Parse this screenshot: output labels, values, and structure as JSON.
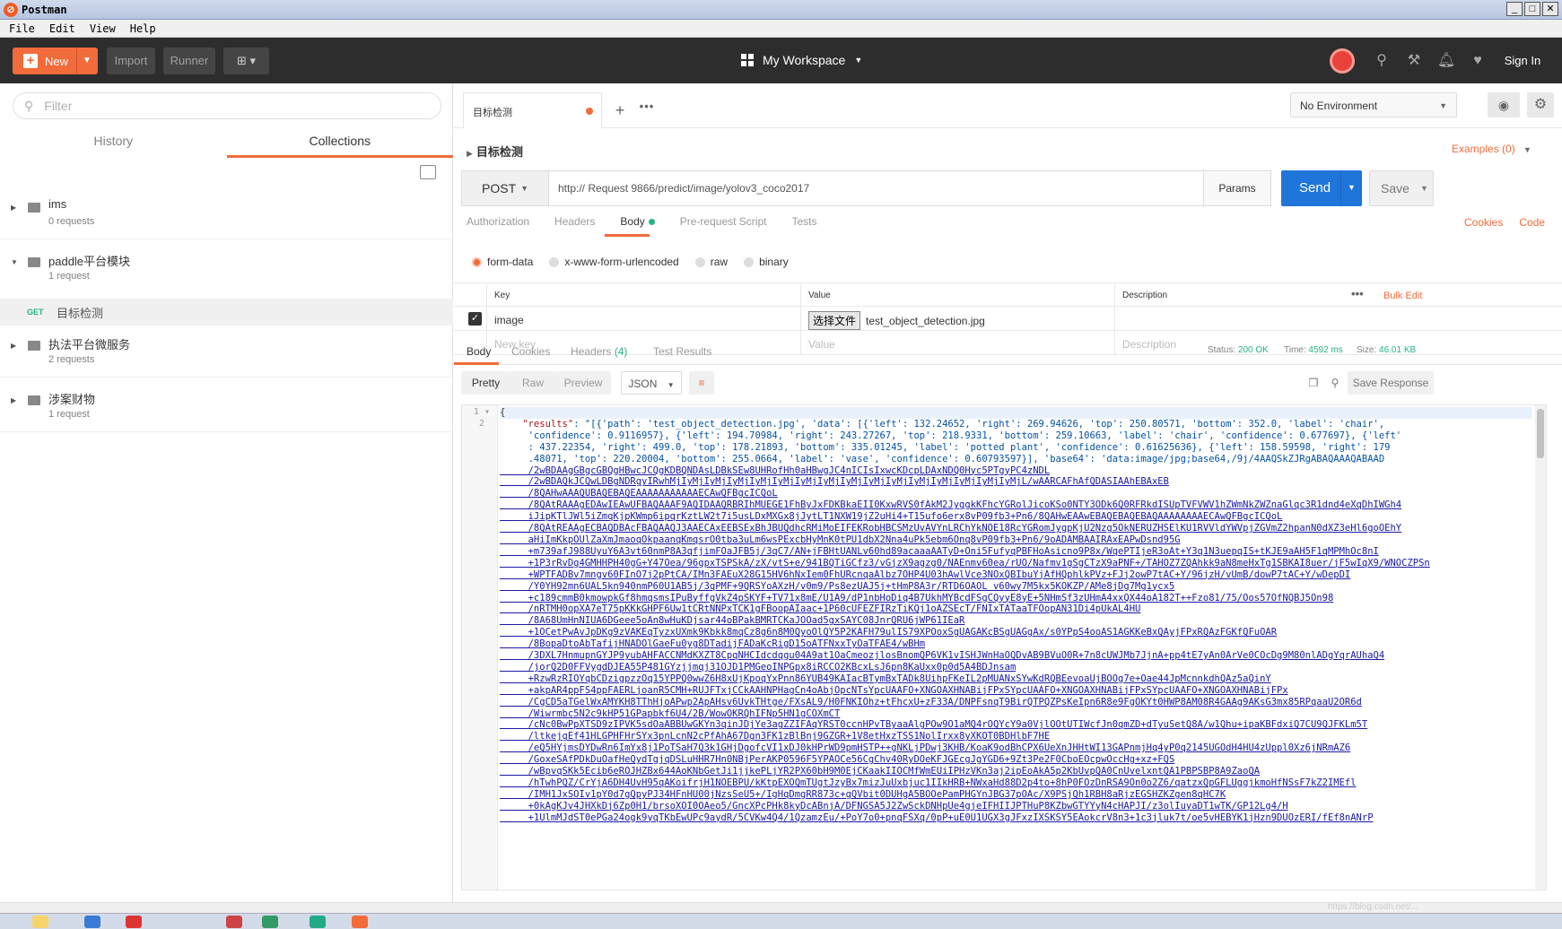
{
  "app": {
    "title": "Postman"
  },
  "menu": [
    "File",
    "Edit",
    "View",
    "Help"
  ],
  "toolbar": {
    "new_label": "New",
    "import_label": "Import",
    "runner_label": "Runner",
    "workspace": "My Workspace",
    "signin_label": "Sign In"
  },
  "sidebar": {
    "filter_placeholder": "Filter",
    "tabs": [
      "History",
      "Collections"
    ],
    "active_tab": "Collections",
    "collections": [
      {
        "name": "ims",
        "count": "0 requests"
      },
      {
        "name": "paddle平台模块",
        "count": "1 request",
        "expanded": true
      },
      {
        "name": "执法平台微服务",
        "count": "2 requests"
      },
      {
        "name": "涉案财物",
        "count": "1 request"
      }
    ],
    "open_request": {
      "method": "GET",
      "name": "目标检测"
    }
  },
  "tab": {
    "title": "目标检测"
  },
  "environment": {
    "selected": "No Environment"
  },
  "request": {
    "title": "目标检测",
    "examples_label": "Examples (0)",
    "method": "POST",
    "url": "http://          Request 9866/predict/image/yolov3_coco2017",
    "params_label": "Params",
    "send_label": "Send",
    "save_label": "Save",
    "subtabs": [
      "Authorization",
      "Headers",
      "Body",
      "Pre-request Script",
      "Tests"
    ],
    "active_subtab": "Body",
    "cookies_label": "Cookies",
    "code_label": "Code",
    "body_types": [
      "form-data",
      "x-www-form-urlencoded",
      "raw",
      "binary"
    ],
    "selected_body_type": "form-data",
    "table": {
      "headers": {
        "key": "Key",
        "value": "Value",
        "description": "Description"
      },
      "bulk_edit": "Bulk Edit",
      "rows": [
        {
          "key": "image",
          "file_button": "选择文件",
          "value": "test_object_detection.jpg",
          "checked": true
        }
      ],
      "placeholders": {
        "key": "New key",
        "value": "Value",
        "description": "Description"
      }
    }
  },
  "response": {
    "tabs": {
      "body": "Body",
      "cookies": "Cookies",
      "headers": "Headers",
      "headers_count": "(4)",
      "tests": "Test Results"
    },
    "status_label": "Status:",
    "status": "200 OK",
    "time_label": "Time:",
    "time": "4592 ms",
    "size_label": "Size:",
    "size": "46.01 KB",
    "view_buttons": [
      "Pretty",
      "Raw",
      "Preview"
    ],
    "format": "JSON",
    "save_response_label": "Save Response",
    "line_numbers": [
      "1",
      "2"
    ],
    "code_lines": [
      "{",
      "    \"results\": \"[{'path': 'test_object_detection.jpg', 'data': [{'left': 132.24652, 'right': 269.94626, 'top': 250.80571, 'bottom': 352.0, 'label': 'chair',",
      "     'confidence': 0.9116957}, {'left': 194.70984, 'right': 243.27267, 'top': 218.9331, 'bottom': 259.10663, 'label': 'chair', 'confidence': 0.677697}, {'left'",
      "     : 437.22354, 'right': 499.0, 'top': 178.21893, 'bottom': 335.01245, 'label': 'potted plant', 'confidence': 0.61625636}, {'left': 158.59598, 'right': 179",
      "     .48071, 'top': 220.20004, 'bottom': 255.0664, 'label': 'vase', 'confidence': 0.60793597}], 'base64': 'data:image/jpg;base64,/9j/4AAQSkZJRgABAQAAAQABAAD",
      "     /2wBDAAgGBgcGBQgHBwcJCQgKDBQNDAsLDBkSEw8UHRofHh0aHBwgJC4nICIsIxwcKDcpLDAxNDQ0Hyc5PTgyPC4zNDL",
      "     /2wBDAQkJCQwLDBgNDRgyIRwhMjIyMjIyMjIyMjIyMjIyMjIyMjIyMjIyMjIyMjIyMjIyMjIyMjIyMjIyMjIyMjL/wAARCAFhAfQDASIAAhEBAxEB",
      "     /8QAHwAAAQUBAQEBAQEAAAAAAAAAAAECAwQFBgcICQoL",
      "     /8QAtRAAAgEDAwIEAwUFBAQAAAF9AQIDAAQRBRIhMUEGE1FhByJxFDKBkaEII0KxwRVS0fAkM2JyggkKFhcYGRolJicoKSo0NTY3ODk6Q0RFRkdISUpTVFVWV1hZWmNkZWZnaGlqc3R1dnd4eXqDhIWGh4",
      "     iJipKTlJWl5iZmqKjpKWmp6ipqrKztLW2t7i5usLDxMXGx8jJytLT1NXW19jZ2uHi4+T15ufo6erx8vP09fb3+Pn6/8QAHwEAAwEBAQEBAQEBAQAAAAAAAAECAwQFBgcICQoL",
      "     /8QAtREAAgECBAQDBAcFBAQAAQJ3AAECAxEEBSExBhJBUQdhcRMiMoEIFEKRobHBCSMzUvAVYnLRChYkNOE18RcYGRomJygpKjU2Nzg5OkNERUZHSElKU1RVVldYWVpjZGVmZ2hpanN0dXZ3eHl6goOEhY",
      "     aHiImKkpOUlZaXmJmaoqOkpaanqKmqsrO0tba3uLm6wsPExcbHyMnK0tPU1dbX2Nna4uPk5ebm6Onq8vP09fb3+Pn6/9oADAMBAAIRAxEAPwDsnd95G",
      "     +m739afJ988UyuY6A3vt60nmP8A3qfjimFOaJFB5j/3qC7/AN+jFBHtUANLv60hd89acaaaAATyD+Oni5FufyqPBFHoAsicno9P8x/WqePTIjeR3oAt+Y3q1N3uepqIS+tKJE9aAH5F1qMPMhOc8nI",
      "     +1P3rRvDg4GMHHPH40gG+Y47Oea/96gpxTSPSkA/zX/vtS+e/941BQTiGCfz3/vGjzX9agzg0/NAEnmv60ea/rUO/Nafmv1gSgCTzX9aPNF+/TAHOZ7ZQAhkk9aN8meHxTg1SBKAI8uer/jF5wIqX9/WNOCZPSn",
      "     +WPTFADBv7mngv60FInO7j2pPtCA/IMn3FAEuX28G15HV6hNxIem0FhURcnqaAlbz7OHP4U03hAwlVce3NOxQBIbuYjAfHQphlkPVz+FJj2owP7tAC+Y/96jzH/vUmB/dowP7tAC+Y/wDepDI",
      "     /Y0YH92mn6UAL5kn940nmP60U1AB5j/3qPMF+9QRSYoAXzH/v0m9/Ps8ezUAJ5j+tHmP8A3r/RTD6OAOL v60wy7M5kx5KOKZP/AMe8jDg7Mg1ycx5",
      "     +c189cmmB0kmowpkGf8hmqsmsIPuByffgVkZ4pSKYF+TV71x8mE/U1A9/dP1nbHoDiq4B7UkhMYBcdFSgCQyyE8yE+5NHmSf3zUHmA4xxQX44oA182T++Fzo81/75/Oos57OfNQBJ5On98",
      "     /nRTMH0opXA7eT75pKKkGHPF6Uw1tCRtNNPxTCK1gFBoopAIaac+1P60cUFEZFIRzTiKQj1oAZSEcT/FNIxTATaaTFOopAN31Di4pUkAL4HU",
      "     /8A68UmHnNIUA6DGeee5oAn8wHuKDjsar44oBPakBMRTCKaJOOad5gxSAYC08JnrQRU6jWP61IEaR",
      "     +1OCetPwAvJpDKg9zVAKEqTyzxUXmk9Kbkk8mqCz8g6n8M0QyoOlQY5P2KAFH79ulIS79XPOoxSgUAGAKcBSgUAGgAx/s0YPpS4ooAS1AGKKeBxQAyjFPxRQAzFGKfQFuOAR",
      "     /8BopaDtoAbTafijHNADOlGaeFu0yg8DTadijFADaKcRigD15oATFNxxTyOaTFAE4/wBHm",
      "     /3DXL7HnmupnGYJP9yubAHFACCNMdKXZT8CpqNHCIdcdqgu04A9at1OaCmeozjlosBnomQP6VK1vISHJWnHaOQDvAB9BVuO0R+7n8cUWJMb7JjnA+pp4tE7yAn0ArVe0COcDg9M80nlADgYqrAUhaQ4",
      "     /jorQ2D0FFVygdDJEA55P481GYzjjmqj31OJD1PMGeoINPGpx8iRCCO2KBcxLsJ6pn8KaUxx0p0d5A4BDJnsam",
      "     +RzwRzRIOYqbCDzigpzzOq15YPPQ0wwZ6H8xUjKpoqYxPnn86YUB49KAIacBTymBxTADk8UihpFKeIL2pMUANxSYwKdRQBEevoaUjBOOg7e+Oae44JpMcnnkdhQAz5aQinY",
      "     +akpAR4ppFS4ppFAERLjoanR5CMH+RUJFTxjCCkAAHNPHagCn4oAbjOpcNTsYpcUAAFO+XNGOAXHNABijFPxSYpcUAAFO+XNGOAXHNABijFPxSYpcUAAFO+XNGOAXHNABijFPx",
      "     /CgCD5aTGelWxAMYKH8TThHjoAPwp2ApAHsv6UvkTHtge/FXsAL9/H0FNKIOhz+tFhcxU+zF33A/DNPFsnqT9BirQTPQZPsKeIpn6R8e9FgOKYt0HWP8AM08R4GAAg9AKsG3mx85RPqaaU2OR6d",
      "     /Wiwrmbc5N2c9kHP51GPapbkf6U4/2B/WowOKRQhIFNp5HN1gCOXmCT",
      "     /cNc0BwPpXTSD9zIPVK5sdOaABBUwGKYn3qinJDjYe3agZZIFAqYRST0ccnHPvTByaaAlgPOw9O1aMQ4rOQYcY9a0VjlOOtUTIWcfJn0qmZD+dTyuSetQ8A/w1Qhu+ipaKBFdxiQ7CU9QJFKLm5T",
      "     /ltkejgEf41HLGPHFHrSYx3pnLcnN2cPfAhA67Dgn3FK1zBlBnj9GZGR+1V8etHxzTSS1NolIrxx8yXKOT0BDHlbF7HE",
      "     /eQ5HYjmsDYDwRn6ImYx8j1PoTSaH7Q3k1GHjDgofcVI1xDJ0kHPrWD9pmHSTP++gNKLjPDwj3KHB/KoaK9odBhCPX6UeXnJHHtWI13GAPnmjHq4yP0q2145UGOdH4HU4zUppl0Xz6jNRmAZ6",
      "     /GoxeSAfPDkDuOafHeQydTgjqDSLuHHR7Hn0NBjPerAKP0596F5YPAOCe56CgChv40RyDOeKFJGEcgJgYGD6+9Zt3Pe2F0CboEOcpwOccHg+xz+FQS",
      "     /wBpvqSKk5Ecib6eROJHZBx644AoKNbGetJi1jjkePLjYR2PX60bH9M0EjCKaakIIOCMfWmEUiIPHzVKn3aj2ipEoAkA5p2KbUvpQA0CnUvelxntQA1PBPSBP8A9ZaoQA",
      "     /hTwhPQZ/CrYjA6DH4UvH95qAKoifrjH1NOEBPU/kKtpEXOQmTUgtJzyBx7mizJuUxbjuc1IIkHRB+NWxaHd88D2p4to+8hP0FOzDnRSA9On0o2Z6/qatzxQpGFLUggjkmoHfNSsF7kZ2IMEfl",
      "     /IMH1JxSOIv1pY0d7gQpyPJ34HFnHU00jNzsSeU5+/IgHqDmgRR873c+gQVbit0DUHgA5BOOePamPHGYnJBG37pOAc/X9PSjQh1RBH8aRjzEGSHZKZgen8qHC7K",
      "     +0kAgKJv4JHXkDj6Zp0H1/brsoXOI0OAeo5/GncXPcPHk8kyDcABnjA/DFNGSA5J2ZwSckDNHpUe4gjeIFHIIJPTHuP8KZbwGTYYyN4cHAPJI/z3olIuyaDT1wTK/GP12Lg4/H",
      "     +1UlmMJdST0ePGa24ogk9yqTKbEwUPc9aydR/5CVKw4Q4/1QzamzEu/+PoY7o0+pnqFSXq/0pP+uE0U1UGX3gJFxzIXSKSY5EAokcrV8n3+1c3jluk7t/oe5vHEBYK1jHzn9DUOzERI/fEf8nANrP"
    ]
  },
  "watermark": "https://blog.csdn.net/..."
}
